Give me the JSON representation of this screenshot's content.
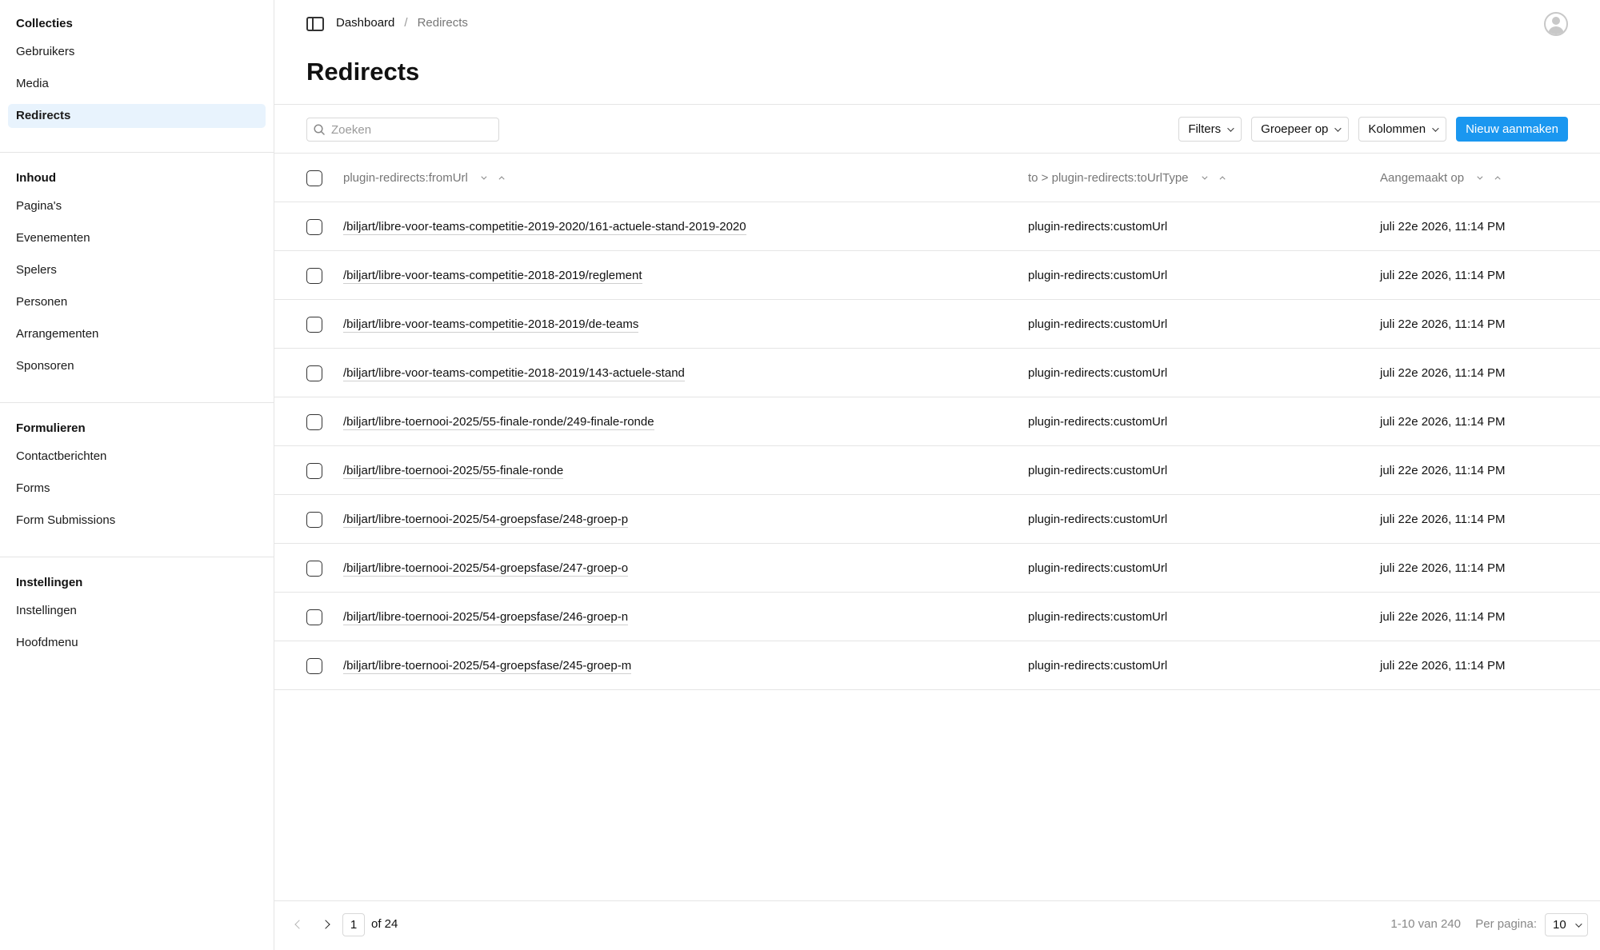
{
  "sidebar": {
    "groups": [
      {
        "title": "Collecties",
        "items": [
          {
            "label": "Gebruikers",
            "active": false
          },
          {
            "label": "Media",
            "active": false
          },
          {
            "label": "Redirects",
            "active": true
          }
        ]
      },
      {
        "title": "Inhoud",
        "items": [
          {
            "label": "Pagina's"
          },
          {
            "label": "Evenementen"
          },
          {
            "label": "Spelers"
          },
          {
            "label": "Personen"
          },
          {
            "label": "Arrangementen"
          },
          {
            "label": "Sponsoren"
          }
        ]
      },
      {
        "title": "Formulieren",
        "items": [
          {
            "label": "Contactberichten"
          },
          {
            "label": "Forms"
          },
          {
            "label": "Form Submissions"
          }
        ]
      },
      {
        "title": "Instellingen",
        "items": [
          {
            "label": "Instellingen"
          },
          {
            "label": "Hoofdmenu"
          }
        ]
      }
    ]
  },
  "breadcrumb": {
    "home": "Dashboard",
    "separator": "/",
    "current": "Redirects"
  },
  "page": {
    "title": "Redirects"
  },
  "toolbar": {
    "search_placeholder": "Zoeken",
    "search_value": "",
    "filters_label": "Filters",
    "group_label": "Groepeer op",
    "columns_label": "Kolommen",
    "create_label": "Nieuw aanmaken"
  },
  "colors": {
    "accent": "#1a97f0",
    "active_nav_bg": "#e8f3fd"
  },
  "table": {
    "columns": [
      "plugin-redirects:fromUrl",
      "to > plugin-redirects:toUrlType",
      "Aangemaakt op"
    ],
    "rows": [
      {
        "from": "/biljart/libre-voor-teams-competitie-2019-2020/161-actuele-stand-2019-2020",
        "type": "plugin-redirects:customUrl",
        "created": "juli 22e 2026, 11:14 PM"
      },
      {
        "from": "/biljart/libre-voor-teams-competitie-2018-2019/reglement",
        "type": "plugin-redirects:customUrl",
        "created": "juli 22e 2026, 11:14 PM"
      },
      {
        "from": "/biljart/libre-voor-teams-competitie-2018-2019/de-teams",
        "type": "plugin-redirects:customUrl",
        "created": "juli 22e 2026, 11:14 PM"
      },
      {
        "from": "/biljart/libre-voor-teams-competitie-2018-2019/143-actuele-stand",
        "type": "plugin-redirects:customUrl",
        "created": "juli 22e 2026, 11:14 PM"
      },
      {
        "from": "/biljart/libre-toernooi-2025/55-finale-ronde/249-finale-ronde",
        "type": "plugin-redirects:customUrl",
        "created": "juli 22e 2026, 11:14 PM"
      },
      {
        "from": "/biljart/libre-toernooi-2025/55-finale-ronde",
        "type": "plugin-redirects:customUrl",
        "created": "juli 22e 2026, 11:14 PM"
      },
      {
        "from": "/biljart/libre-toernooi-2025/54-groepsfase/248-groep-p",
        "type": "plugin-redirects:customUrl",
        "created": "juli 22e 2026, 11:14 PM"
      },
      {
        "from": "/biljart/libre-toernooi-2025/54-groepsfase/247-groep-o",
        "type": "plugin-redirects:customUrl",
        "created": "juli 22e 2026, 11:14 PM"
      },
      {
        "from": "/biljart/libre-toernooi-2025/54-groepsfase/246-groep-n",
        "type": "plugin-redirects:customUrl",
        "created": "juli 22e 2026, 11:14 PM"
      },
      {
        "from": "/biljart/libre-toernooi-2025/54-groepsfase/245-groep-m",
        "type": "plugin-redirects:customUrl",
        "created": "juli 22e 2026, 11:14 PM"
      }
    ]
  },
  "pagination": {
    "current_page": "1",
    "of_text": "of 24",
    "range_text": "1-10 van 240",
    "per_page_label": "Per pagina:",
    "per_page_value": "10"
  }
}
